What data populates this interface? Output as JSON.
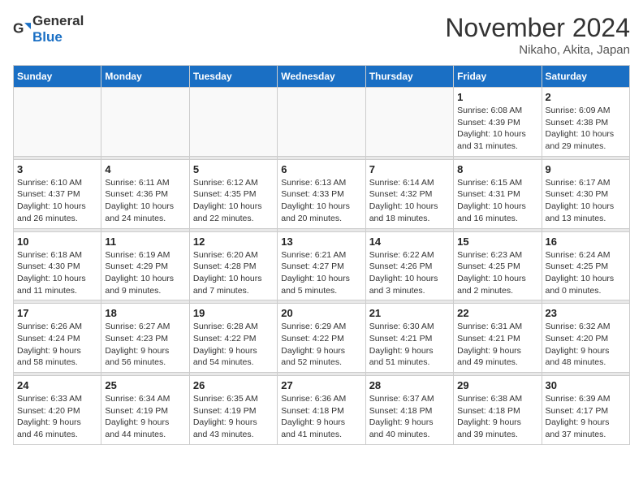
{
  "header": {
    "logo_general": "General",
    "logo_blue": "Blue",
    "month_title": "November 2024",
    "location": "Nikaho, Akita, Japan"
  },
  "weekdays": [
    "Sunday",
    "Monday",
    "Tuesday",
    "Wednesday",
    "Thursday",
    "Friday",
    "Saturday"
  ],
  "weeks": [
    [
      {
        "day": "",
        "info": ""
      },
      {
        "day": "",
        "info": ""
      },
      {
        "day": "",
        "info": ""
      },
      {
        "day": "",
        "info": ""
      },
      {
        "day": "",
        "info": ""
      },
      {
        "day": "1",
        "info": "Sunrise: 6:08 AM\nSunset: 4:39 PM\nDaylight: 10 hours\nand 31 minutes."
      },
      {
        "day": "2",
        "info": "Sunrise: 6:09 AM\nSunset: 4:38 PM\nDaylight: 10 hours\nand 29 minutes."
      }
    ],
    [
      {
        "day": "3",
        "info": "Sunrise: 6:10 AM\nSunset: 4:37 PM\nDaylight: 10 hours\nand 26 minutes."
      },
      {
        "day": "4",
        "info": "Sunrise: 6:11 AM\nSunset: 4:36 PM\nDaylight: 10 hours\nand 24 minutes."
      },
      {
        "day": "5",
        "info": "Sunrise: 6:12 AM\nSunset: 4:35 PM\nDaylight: 10 hours\nand 22 minutes."
      },
      {
        "day": "6",
        "info": "Sunrise: 6:13 AM\nSunset: 4:33 PM\nDaylight: 10 hours\nand 20 minutes."
      },
      {
        "day": "7",
        "info": "Sunrise: 6:14 AM\nSunset: 4:32 PM\nDaylight: 10 hours\nand 18 minutes."
      },
      {
        "day": "8",
        "info": "Sunrise: 6:15 AM\nSunset: 4:31 PM\nDaylight: 10 hours\nand 16 minutes."
      },
      {
        "day": "9",
        "info": "Sunrise: 6:17 AM\nSunset: 4:30 PM\nDaylight: 10 hours\nand 13 minutes."
      }
    ],
    [
      {
        "day": "10",
        "info": "Sunrise: 6:18 AM\nSunset: 4:30 PM\nDaylight: 10 hours\nand 11 minutes."
      },
      {
        "day": "11",
        "info": "Sunrise: 6:19 AM\nSunset: 4:29 PM\nDaylight: 10 hours\nand 9 minutes."
      },
      {
        "day": "12",
        "info": "Sunrise: 6:20 AM\nSunset: 4:28 PM\nDaylight: 10 hours\nand 7 minutes."
      },
      {
        "day": "13",
        "info": "Sunrise: 6:21 AM\nSunset: 4:27 PM\nDaylight: 10 hours\nand 5 minutes."
      },
      {
        "day": "14",
        "info": "Sunrise: 6:22 AM\nSunset: 4:26 PM\nDaylight: 10 hours\nand 3 minutes."
      },
      {
        "day": "15",
        "info": "Sunrise: 6:23 AM\nSunset: 4:25 PM\nDaylight: 10 hours\nand 2 minutes."
      },
      {
        "day": "16",
        "info": "Sunrise: 6:24 AM\nSunset: 4:25 PM\nDaylight: 10 hours\nand 0 minutes."
      }
    ],
    [
      {
        "day": "17",
        "info": "Sunrise: 6:26 AM\nSunset: 4:24 PM\nDaylight: 9 hours\nand 58 minutes."
      },
      {
        "day": "18",
        "info": "Sunrise: 6:27 AM\nSunset: 4:23 PM\nDaylight: 9 hours\nand 56 minutes."
      },
      {
        "day": "19",
        "info": "Sunrise: 6:28 AM\nSunset: 4:22 PM\nDaylight: 9 hours\nand 54 minutes."
      },
      {
        "day": "20",
        "info": "Sunrise: 6:29 AM\nSunset: 4:22 PM\nDaylight: 9 hours\nand 52 minutes."
      },
      {
        "day": "21",
        "info": "Sunrise: 6:30 AM\nSunset: 4:21 PM\nDaylight: 9 hours\nand 51 minutes."
      },
      {
        "day": "22",
        "info": "Sunrise: 6:31 AM\nSunset: 4:21 PM\nDaylight: 9 hours\nand 49 minutes."
      },
      {
        "day": "23",
        "info": "Sunrise: 6:32 AM\nSunset: 4:20 PM\nDaylight: 9 hours\nand 48 minutes."
      }
    ],
    [
      {
        "day": "24",
        "info": "Sunrise: 6:33 AM\nSunset: 4:20 PM\nDaylight: 9 hours\nand 46 minutes."
      },
      {
        "day": "25",
        "info": "Sunrise: 6:34 AM\nSunset: 4:19 PM\nDaylight: 9 hours\nand 44 minutes."
      },
      {
        "day": "26",
        "info": "Sunrise: 6:35 AM\nSunset: 4:19 PM\nDaylight: 9 hours\nand 43 minutes."
      },
      {
        "day": "27",
        "info": "Sunrise: 6:36 AM\nSunset: 4:18 PM\nDaylight: 9 hours\nand 41 minutes."
      },
      {
        "day": "28",
        "info": "Sunrise: 6:37 AM\nSunset: 4:18 PM\nDaylight: 9 hours\nand 40 minutes."
      },
      {
        "day": "29",
        "info": "Sunrise: 6:38 AM\nSunset: 4:18 PM\nDaylight: 9 hours\nand 39 minutes."
      },
      {
        "day": "30",
        "info": "Sunrise: 6:39 AM\nSunset: 4:17 PM\nDaylight: 9 hours\nand 37 minutes."
      }
    ]
  ]
}
